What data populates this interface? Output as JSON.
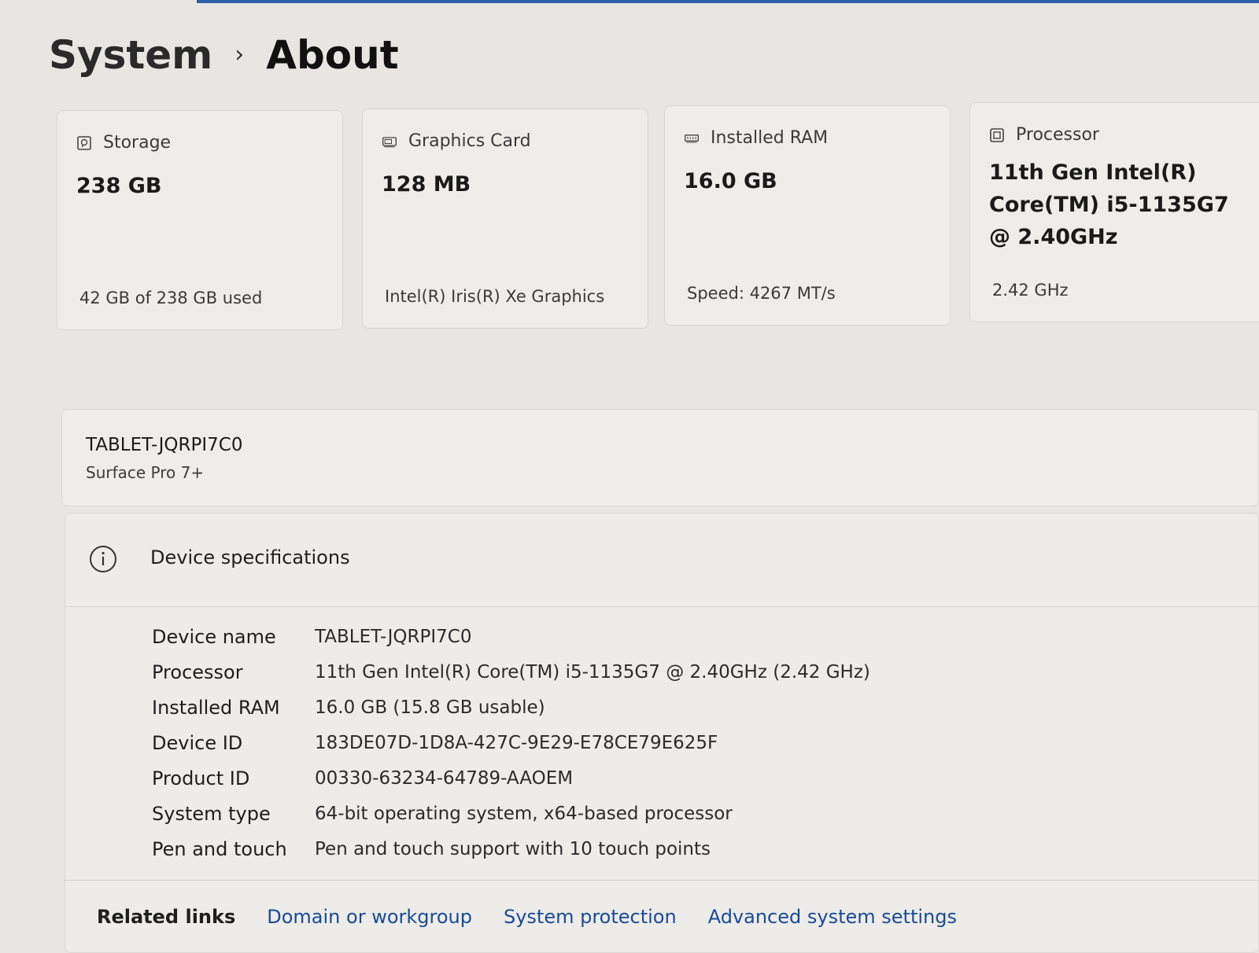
{
  "breadcrumb": {
    "parent": "System",
    "separator": "›",
    "current": "About"
  },
  "cards": {
    "storage": {
      "icon": "storage-icon",
      "title": "Storage",
      "value": "238 GB",
      "footer": "42 GB of 238 GB used"
    },
    "graphics": {
      "icon": "graphics-card-icon",
      "title": "Graphics Card",
      "value": "128 MB",
      "footer": "Intel(R) Iris(R) Xe Graphics"
    },
    "ram": {
      "icon": "ram-icon",
      "title": "Installed RAM",
      "value": "16.0 GB",
      "footer": "Speed: 4267 MT/s"
    },
    "processor": {
      "icon": "processor-icon",
      "title": "Processor",
      "value": "11th Gen Intel(R) Core(TM) i5-1135G7 @ 2.40GHz",
      "footer": "2.42 GHz"
    }
  },
  "device": {
    "name": "TABLET-JQRPI7C0",
    "model": "Surface Pro 7+"
  },
  "specs": {
    "title": "Device specifications",
    "icon": "info-icon",
    "rows": [
      {
        "label": "Device name",
        "value": "TABLET-JQRPI7C0"
      },
      {
        "label": "Processor",
        "value": "11th Gen Intel(R) Core(TM) i5-1135G7 @ 2.40GHz (2.42 GHz)"
      },
      {
        "label": "Installed RAM",
        "value": "16.0 GB (15.8 GB usable)"
      },
      {
        "label": "Device ID",
        "value": "183DE07D-1D8A-427C-9E29-E78CE79E625F"
      },
      {
        "label": "Product ID",
        "value": "00330-63234-64789-AAOEM"
      },
      {
        "label": "System type",
        "value": "64-bit operating system, x64-based processor"
      },
      {
        "label": "Pen and touch",
        "value": "Pen and touch support with 10 touch points"
      }
    ]
  },
  "related_links": {
    "label": "Related links",
    "links": [
      "Domain or workgroup",
      "System protection",
      "Advanced system settings"
    ]
  },
  "colors": {
    "background": "#e7e6e3",
    "card": "#eeedea",
    "link": "#1a4a96",
    "accent": "#2f5fa8"
  }
}
